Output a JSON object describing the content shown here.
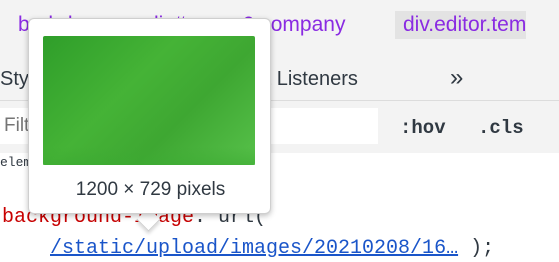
{
  "breadcrumbs": [
    {
      "label": "body.home",
      "kind": "tag"
    },
    {
      "label": "div#pages0.company",
      "kind": "id"
    },
    {
      "label": "div.editor.tem",
      "kind": "active"
    }
  ],
  "tabs": {
    "styles": "Styles",
    "event_listeners": "Event Listeners",
    "more": "»"
  },
  "filter": {
    "placeholder": "Filter",
    "hov": ":hov",
    "cls": ".cls"
  },
  "styles_pane": {
    "element_label": "element.style",
    "property": "background-image",
    "func_open": "url(",
    "url": "/static/upload/images/20210208/16…",
    "close": " );"
  },
  "tooltip": {
    "dimensions": "1200 × 729 pixels",
    "preview_color": "#3ea732"
  }
}
